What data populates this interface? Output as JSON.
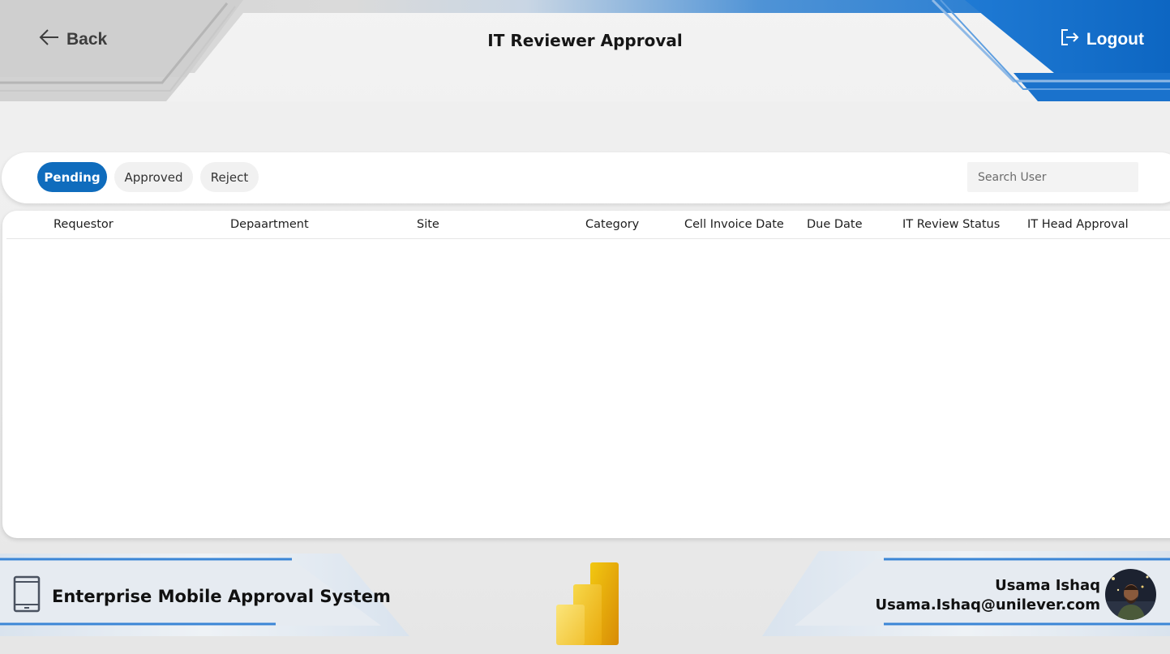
{
  "header": {
    "back_label": "Back",
    "title": "IT Reviewer Approval",
    "logout_label": "Logout"
  },
  "tabs": [
    {
      "label": "Pending",
      "active": true
    },
    {
      "label": "Approved",
      "active": false
    },
    {
      "label": "Reject",
      "active": false
    }
  ],
  "search": {
    "placeholder": "Search User",
    "value": ""
  },
  "table": {
    "columns": [
      "Requestor",
      "Depaartment",
      "Site",
      "Category",
      "Cell Invoice Date",
      "Due Date",
      "IT Review Status",
      "IT Head Approval"
    ],
    "rows": []
  },
  "footer": {
    "system_name": "Enterprise Mobile Approval System",
    "user_name": "Usama Ishaq",
    "user_email": "Usama.Ishaq@unilever.com"
  },
  "icons": {
    "back": "arrow-left-icon",
    "logout": "logout-icon",
    "device": "mobile-device-icon",
    "logo": "power-bi-logo-icon",
    "avatar": "user-avatar"
  },
  "colors": {
    "accent": "#0f6cbd",
    "header_blue": "#1a74cf",
    "text_dark": "#161616"
  }
}
